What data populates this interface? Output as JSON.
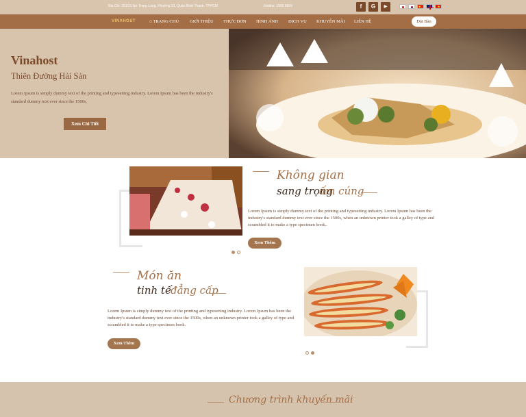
{
  "topbar": {
    "address": "Địa Chỉ: 351/31 Nơ Trang Long, Phường 13, Quận Bình Thạnh, TPHCM",
    "hotline": "Hotline: 1900 6666",
    "social": [
      {
        "icon": "facebook-icon",
        "glyph": "f"
      },
      {
        "icon": "google-plus-icon",
        "glyph": "G"
      },
      {
        "icon": "youtube-icon",
        "glyph": "▶"
      }
    ],
    "flags": [
      "japan-flag-icon",
      "korea-flag-icon",
      "china-flag-icon",
      "uk-flag-icon",
      "vietnam-flag-icon"
    ]
  },
  "nav": {
    "logo": "VINAHOST",
    "items": [
      "TRANG CHỦ",
      "GIỚI THIỆU",
      "THỰC ĐƠN",
      "HÌNH ẢNH",
      "DỊCH VỤ",
      "KHUYẾN MÃI",
      "LIÊN HỆ"
    ],
    "home_icon": "home-icon",
    "book_button": "Đặt Bàn"
  },
  "hero": {
    "title": "Vinahost",
    "subtitle": "Thiên Đường Hải Sản",
    "description": "Lorem Ipsum is simply dummy text of the printing and typesetting industry. Lorem Ipsum has been the industry's standard dummy text ever since the 1500s,",
    "button": "Xem Chi Tiết"
  },
  "section1": {
    "script_line1": "Không gian",
    "script_line2a": "sang trọng",
    "script_line2b": "ấm cúng",
    "text": "Lorem Ipsum is simply dummy text of the printing and typesetting industry. Lorem Ipsum has been the industry's standard dummy text ever since the 1500s, when an unknown printer took a galley of type and scrambled it to make a type specimen book..",
    "button": "Xem Thêm"
  },
  "section2": {
    "script_line1": "Món ăn",
    "script_line2a": "tinh tế",
    "script_line2b": "đẳng cấp",
    "text": "Lorem Ipsum is simply dummy text of the printing and typesetting industry. Lorem Ipsum has been the industry's standard dummy text ever since the 1500s, when an unknown printer took a galley of type and scrambled it to make a type specimen book.",
    "button": "Xem Thêm"
  },
  "promo": {
    "title": "Chương trình khuyến mãi"
  },
  "colors": {
    "topbar": "#d9c4ad",
    "nav": "#a36e45",
    "accent": "#9a6842",
    "band": "#d6c3ad"
  }
}
